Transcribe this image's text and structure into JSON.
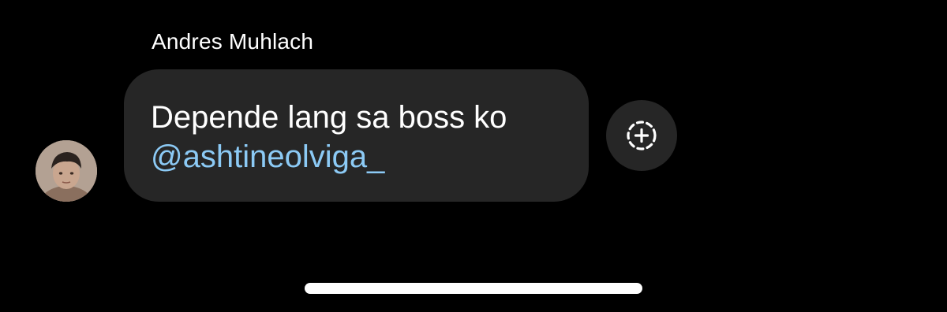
{
  "message": {
    "sender_name": "Andres Muhlach",
    "text": "Depende lang sa boss ko",
    "mention": "@ashtineolviga_"
  },
  "icons": {
    "avatar": "profile-photo",
    "react": "add-reaction-icon"
  },
  "colors": {
    "background": "#000000",
    "bubble": "#262626",
    "mention": "#8ccaf5",
    "text": "#ffffff"
  }
}
